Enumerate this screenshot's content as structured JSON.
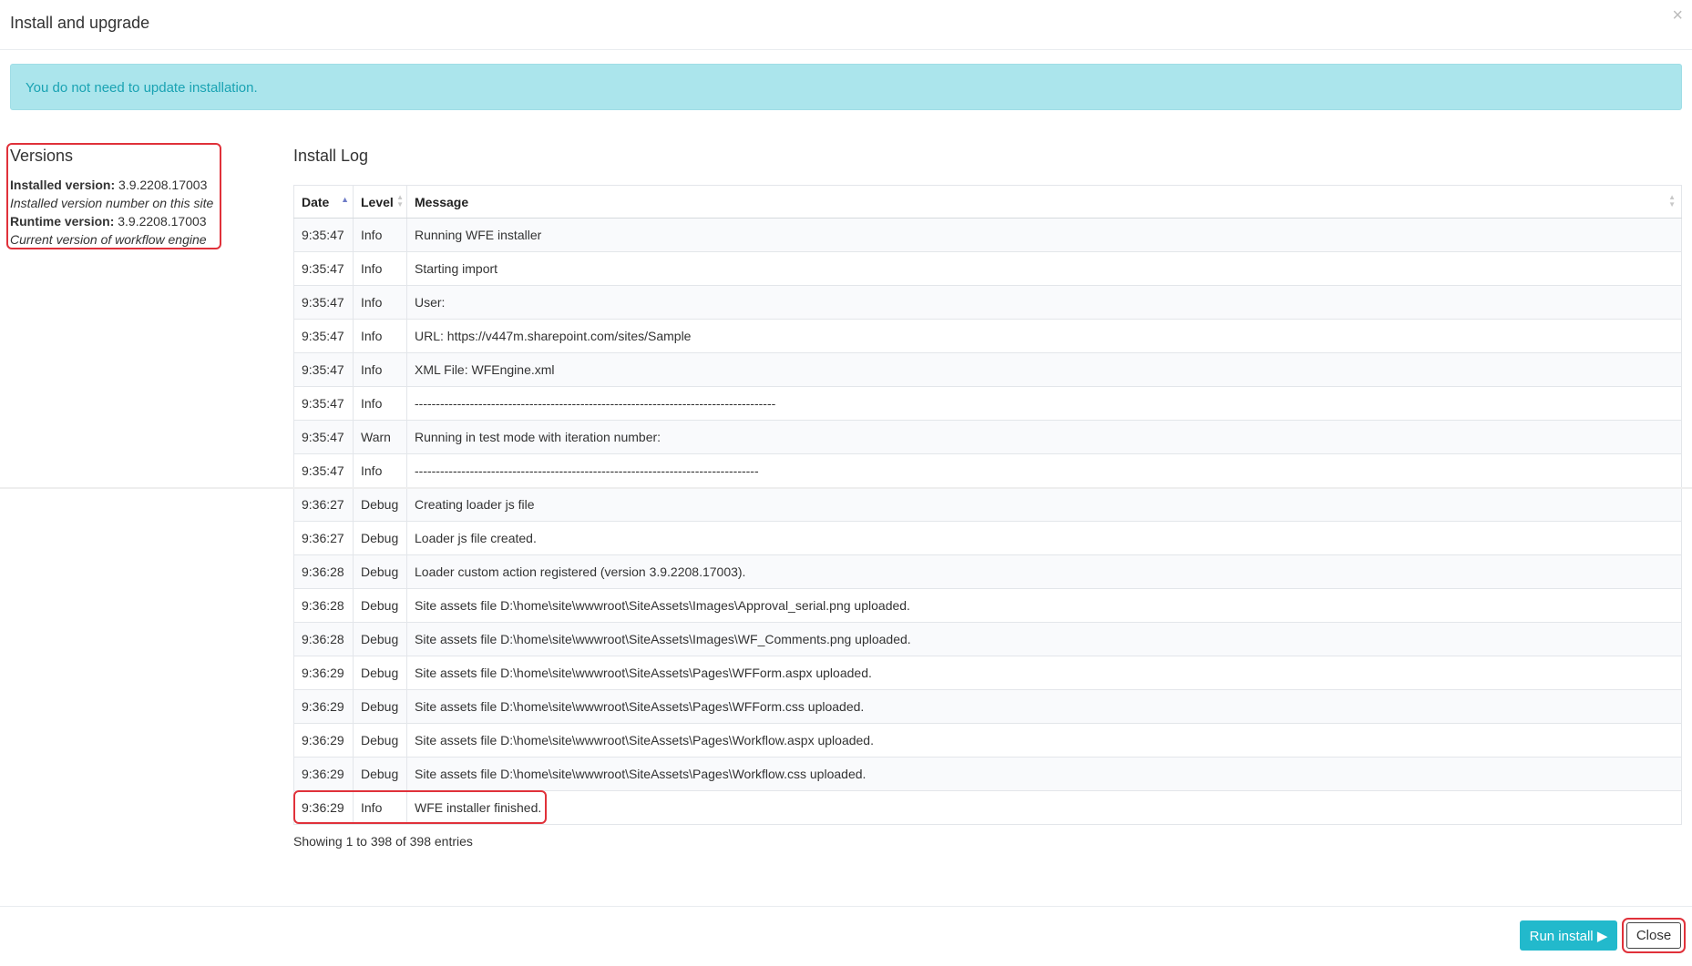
{
  "modal": {
    "title": "Install and upgrade",
    "close_glyph": "×"
  },
  "alert": {
    "text": "You do not need to update installation."
  },
  "versions": {
    "title": "Versions",
    "installed_label": "Installed version:",
    "installed_value": "3.9.2208.17003",
    "installed_note": "Installed version number on this site",
    "runtime_label": "Runtime version:",
    "runtime_value": "3.9.2208.17003",
    "runtime_note": "Current version of workflow engine"
  },
  "log": {
    "title": "Install Log",
    "columns": [
      "Date",
      "Level",
      "Message"
    ],
    "rows": [
      {
        "date": "9:35:47",
        "level": "Info",
        "message": "Running WFE installer"
      },
      {
        "date": "9:35:47",
        "level": "Info",
        "message": "Starting import"
      },
      {
        "date": "9:35:47",
        "level": "Info",
        "message": "User:"
      },
      {
        "date": "9:35:47",
        "level": "Info",
        "message": "URL: https://v447m.sharepoint.com/sites/Sample"
      },
      {
        "date": "9:35:47",
        "level": "Info",
        "message": "XML File: WFEngine.xml"
      },
      {
        "date": "9:35:47",
        "level": "Info",
        "message": "-------------------------------------------------------------------------------------"
      },
      {
        "date": "9:35:47",
        "level": "Warn",
        "message": "Running in test mode with iteration number:"
      },
      {
        "date": "9:35:47",
        "level": "Info",
        "message": "---------------------------------------------------------------------------------"
      },
      {
        "date": "9:36:27",
        "level": "Debug",
        "message": "Creating loader js file"
      },
      {
        "date": "9:36:27",
        "level": "Debug",
        "message": "Loader js file created."
      },
      {
        "date": "9:36:28",
        "level": "Debug",
        "message": "Loader custom action registered (version 3.9.2208.17003)."
      },
      {
        "date": "9:36:28",
        "level": "Debug",
        "message": "Site assets file D:\\home\\site\\wwwroot\\SiteAssets\\Images\\Approval_serial.png uploaded."
      },
      {
        "date": "9:36:28",
        "level": "Debug",
        "message": "Site assets file D:\\home\\site\\wwwroot\\SiteAssets\\Images\\WF_Comments.png uploaded."
      },
      {
        "date": "9:36:29",
        "level": "Debug",
        "message": "Site assets file D:\\home\\site\\wwwroot\\SiteAssets\\Pages\\WFForm.aspx uploaded."
      },
      {
        "date": "9:36:29",
        "level": "Debug",
        "message": "Site assets file D:\\home\\site\\wwwroot\\SiteAssets\\Pages\\WFForm.css uploaded."
      },
      {
        "date": "9:36:29",
        "level": "Debug",
        "message": "Site assets file D:\\home\\site\\wwwroot\\SiteAssets\\Pages\\Workflow.aspx uploaded."
      },
      {
        "date": "9:36:29",
        "level": "Debug",
        "message": "Site assets file D:\\home\\site\\wwwroot\\SiteAssets\\Pages\\Workflow.css uploaded."
      },
      {
        "date": "9:36:29",
        "level": "Info",
        "message": "WFE installer finished."
      }
    ],
    "footer_text": "Showing 1 to 398 of 398 entries"
  },
  "footer": {
    "run_install_label": "Run install",
    "run_install_glyph": "▶",
    "close_label": "Close"
  },
  "colors": {
    "alert_bg": "#abe5ec",
    "alert_text": "#1aa3b3",
    "primary_button": "#22b9cc",
    "highlight_border": "#e0313a"
  }
}
